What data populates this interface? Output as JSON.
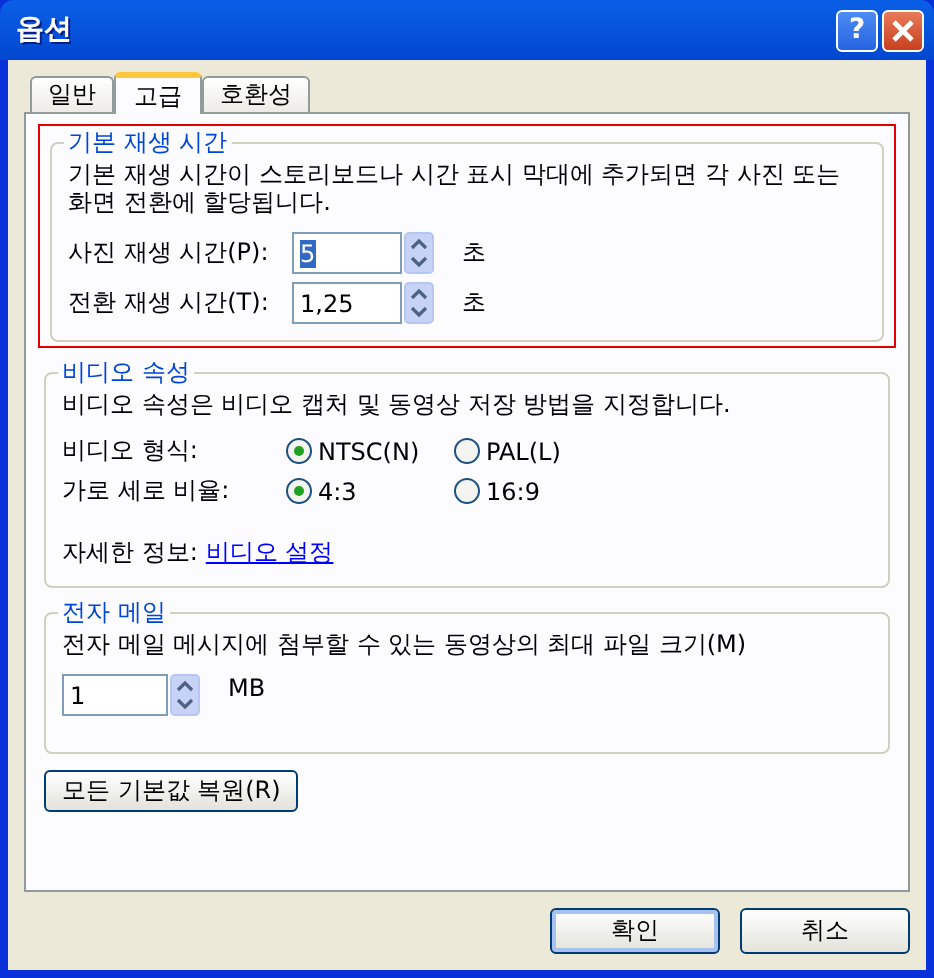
{
  "window": {
    "title": "옵션",
    "help_label": "?"
  },
  "tabs": [
    {
      "label": "일반",
      "selected": false
    },
    {
      "label": "고급",
      "selected": true
    },
    {
      "label": "호환성",
      "selected": false
    }
  ],
  "playback": {
    "title": "기본 재생 시간",
    "highlighted": true,
    "description": "기본 재생 시간이 스토리보드나 시간 표시 막대에 추가되면 각 사진 또는 화면 전환에 할당됩니다.",
    "fields": [
      {
        "label": "사진 재생 시간(P):",
        "value": "5",
        "value_selected": true,
        "unit": "초"
      },
      {
        "label": "전환 재생 시간(T):",
        "value": "1,25",
        "value_selected": false,
        "unit": "초"
      }
    ]
  },
  "video": {
    "title": "비디오 속성",
    "description": "비디오 속성은 비디오 캡처 및 동영상 저장 방법을 지정합니다.",
    "rows": [
      {
        "label": "비디오 형식:",
        "options": [
          {
            "label": "NTSC(N)",
            "selected": true
          },
          {
            "label": "PAL(L)",
            "selected": false
          }
        ]
      },
      {
        "label": "가로 세로 비율:",
        "options": [
          {
            "label": "4:3",
            "selected": true
          },
          {
            "label": "16:9",
            "selected": false
          }
        ]
      }
    ],
    "more_label": "자세한 정보:",
    "more_link": "비디오 설정"
  },
  "email": {
    "title": "전자 메일",
    "description": "전자 메일 메시지에 첨부할 수 있는 동영상의 최대 파일 크기(M)",
    "value": "1",
    "unit": "MB"
  },
  "restore_button": "모든 기본값 복원(R)",
  "buttons": [
    "확인",
    "취소"
  ]
}
